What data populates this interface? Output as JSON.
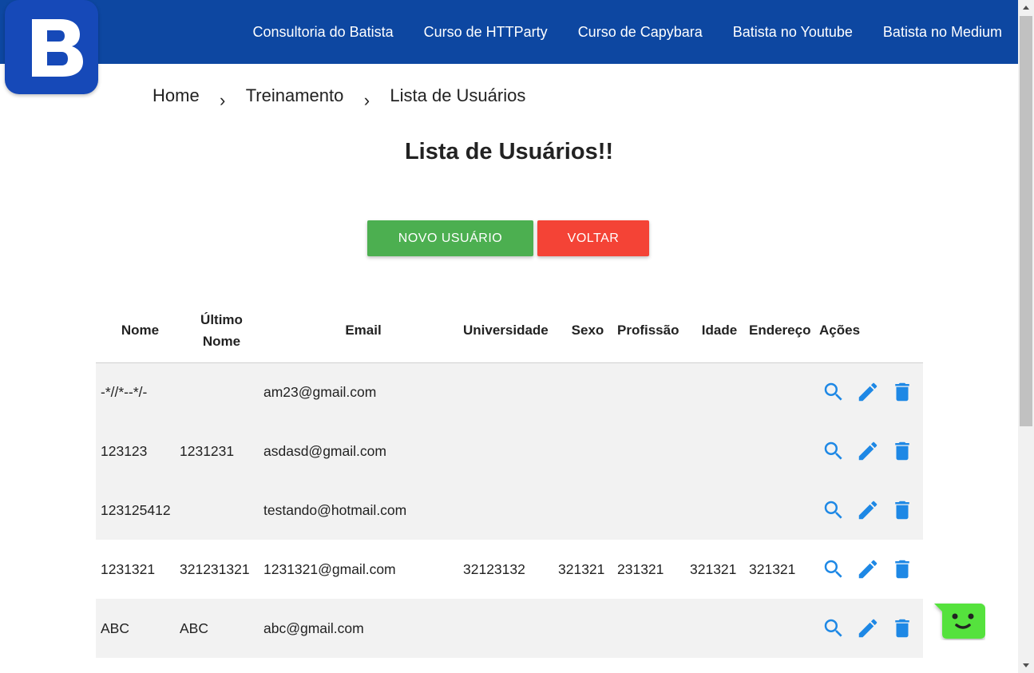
{
  "header": {
    "logo_letter": "B",
    "nav": [
      "Consultoria do Batista",
      "Curso de HTTParty",
      "Curso de Capybara",
      "Batista no Youtube",
      "Batista no Medium"
    ]
  },
  "breadcrumb": [
    "Home",
    "Treinamento",
    "Lista de Usuários"
  ],
  "page_title": "Lista de Usuários!!",
  "buttons": {
    "new_user": "NOVO USUÁRIO",
    "back": "VOLTAR"
  },
  "table": {
    "headers": {
      "nome": "Nome",
      "ultimo_nome_line1": "Último",
      "ultimo_nome_line2": "Nome",
      "email": "Email",
      "universidade": "Universidade",
      "sexo": "Sexo",
      "profissao": "Profissão",
      "idade": "Idade",
      "endereco": "Endereço",
      "acoes": "Ações"
    },
    "rows": [
      {
        "nome": "-*//*--*/-",
        "ultimo_nome": "",
        "email": "am23@gmail.com",
        "universidade": "",
        "sexo": "",
        "profissao": "",
        "idade": "",
        "endereco": ""
      },
      {
        "nome": "123123",
        "ultimo_nome": "1231231",
        "email": "asdasd@gmail.com",
        "universidade": "",
        "sexo": "",
        "profissao": "",
        "idade": "",
        "endereco": ""
      },
      {
        "nome": "123125412",
        "ultimo_nome": "",
        "email": "testando@hotmail.com",
        "universidade": "",
        "sexo": "",
        "profissao": "",
        "idade": "",
        "endereco": ""
      },
      {
        "nome": "1231321",
        "ultimo_nome": "321231321",
        "email": "1231321@gmail.com",
        "universidade": "32123132",
        "sexo": "321321",
        "profissao": "231321",
        "idade": "321321",
        "endereco": "321321"
      },
      {
        "nome": "ABC",
        "ultimo_nome": "ABC",
        "email": "abc@gmail.com",
        "universidade": "",
        "sexo": "",
        "profissao": "",
        "idade": "",
        "endereco": ""
      }
    ],
    "action_icons": [
      "search-icon",
      "edit-icon",
      "delete-icon"
    ]
  },
  "colors": {
    "header_bg": "#0d47a1",
    "new_user_button": "#4caf50",
    "back_button": "#f44336",
    "action_icons": "#1e88e5",
    "row_shade": "#f2f2f2",
    "chat_widget": "#55e23c"
  }
}
